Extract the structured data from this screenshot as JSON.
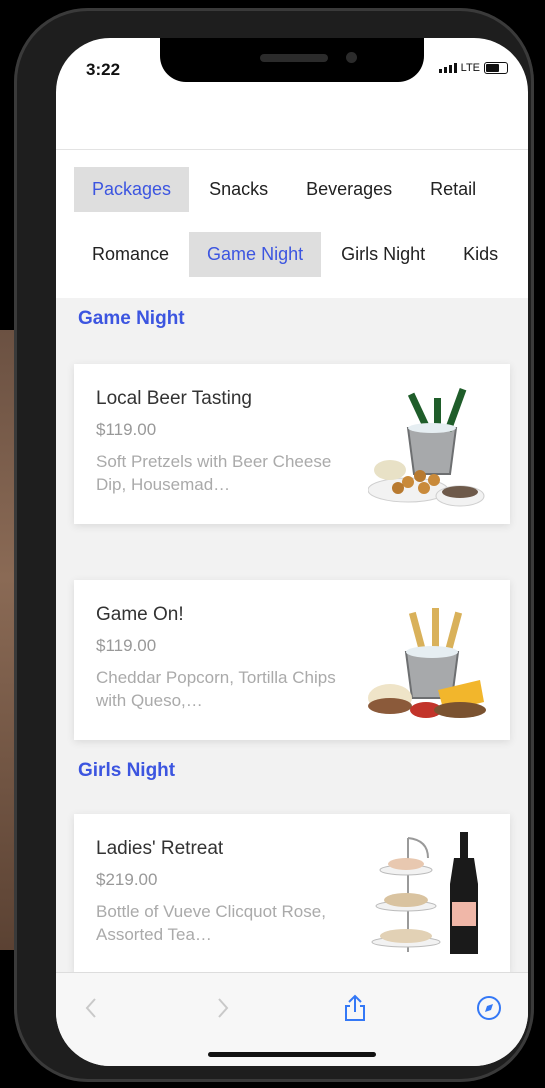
{
  "status": {
    "time": "3:22",
    "network": "LTE"
  },
  "tabs_row1": [
    {
      "label": "Packages",
      "active": true
    },
    {
      "label": "Snacks",
      "active": false
    },
    {
      "label": "Beverages",
      "active": false
    },
    {
      "label": "Retail",
      "active": false
    }
  ],
  "tabs_row2": [
    {
      "label": "Romance",
      "active": false
    },
    {
      "label": "Game Night",
      "active": true
    },
    {
      "label": "Girls Night",
      "active": false
    },
    {
      "label": "Kids",
      "active": false
    }
  ],
  "sections": [
    {
      "title": "Game Night",
      "items": [
        {
          "name": "Local Beer Tasting",
          "price": "$119.00",
          "description": "Soft Pretzels with Beer Cheese Dip, Housemad…",
          "image": "beer-bucket-pretzels"
        },
        {
          "name": "Game On!",
          "price": "$119.00",
          "description": "Cheddar Popcorn, Tortilla Chips with Queso,…",
          "image": "beer-bucket-popcorn-chips"
        }
      ]
    },
    {
      "title": "Girls Night",
      "items": [
        {
          "name": "Ladies' Retreat",
          "price": "$219.00",
          "description": "Bottle of Vueve Clicquot Rose, Assorted Tea…",
          "image": "tea-stand-champagne"
        }
      ]
    }
  ],
  "toolbar": {
    "back_icon": "chevron-left-icon",
    "forward_icon": "chevron-right-icon",
    "share_icon": "share-icon",
    "compass_icon": "compass-icon"
  },
  "colors": {
    "accent": "#3c55e0",
    "active_tab_bg": "#dedede"
  }
}
